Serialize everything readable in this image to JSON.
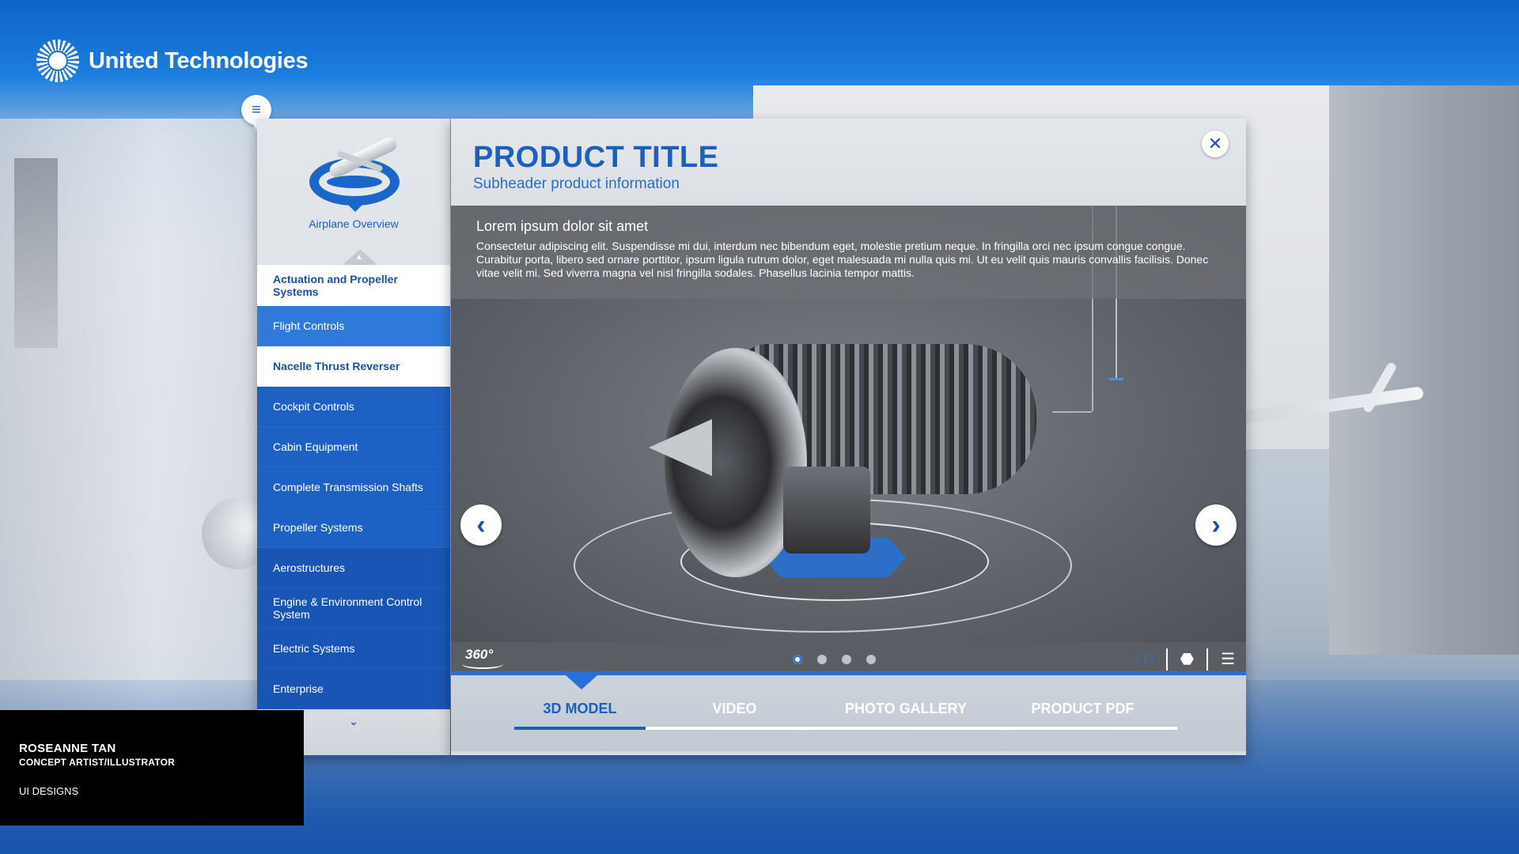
{
  "brand": {
    "name": "United Technologies"
  },
  "sidebar": {
    "overview_label": "Airplane Overview",
    "items": [
      {
        "label": "Actuation and Propeller Systems"
      },
      {
        "label": "Flight Controls"
      },
      {
        "label": "Nacelle Thrust Reverser"
      },
      {
        "label": "Cockpit Controls"
      },
      {
        "label": "Cabin Equipment"
      },
      {
        "label": "Complete Transmission Shafts"
      },
      {
        "label": "Propeller Systems"
      },
      {
        "label": "Aerostructures"
      },
      {
        "label": "Engine & Environment Control System"
      },
      {
        "label": "Electric Systems"
      },
      {
        "label": "Enterprise"
      }
    ]
  },
  "product": {
    "title": "PRODUCT TITLE",
    "subtitle": "Subheader product information",
    "description_title": "Lorem ipsum dolor sit amet",
    "description_body": "Consectetur adipiscing elit. Suspendisse mi dui, interdum nec bibendum eget, molestie pretium neque. In fringilla orci nec ipsum congue congue. Curabitur porta, libero sed ornare porttitor, ipsum ligula rutrum dolor, eget malesuada mi nulla quis mi. Ut eu velit quis mauris convallis facilisis. Donec vitae velit mi. Sed viverra magna vel nisl fringilla sodales. Phasellus lacinia tempor mattis."
  },
  "viewer": {
    "rotate_label": "360°",
    "slides_total": 4,
    "active_slide": 1,
    "icons": [
      "info-icon",
      "cube-icon",
      "list-icon"
    ]
  },
  "tabs": [
    {
      "label": "3D MODEL",
      "active": true
    },
    {
      "label": "VIDEO",
      "active": false
    },
    {
      "label": "PHOTO GALLERY",
      "active": false
    },
    {
      "label": "PRODUCT PDF",
      "active": false
    }
  ],
  "credit": {
    "name": "ROSEANNE TAN",
    "role": "CONCEPT ARTIST/ILLUSTRATOR",
    "section": "UI DESIGNS"
  },
  "colors": {
    "brand_blue": "#1b5fbf",
    "nav_blue": "#1855b5",
    "accent_blue": "#2a6fd4"
  }
}
